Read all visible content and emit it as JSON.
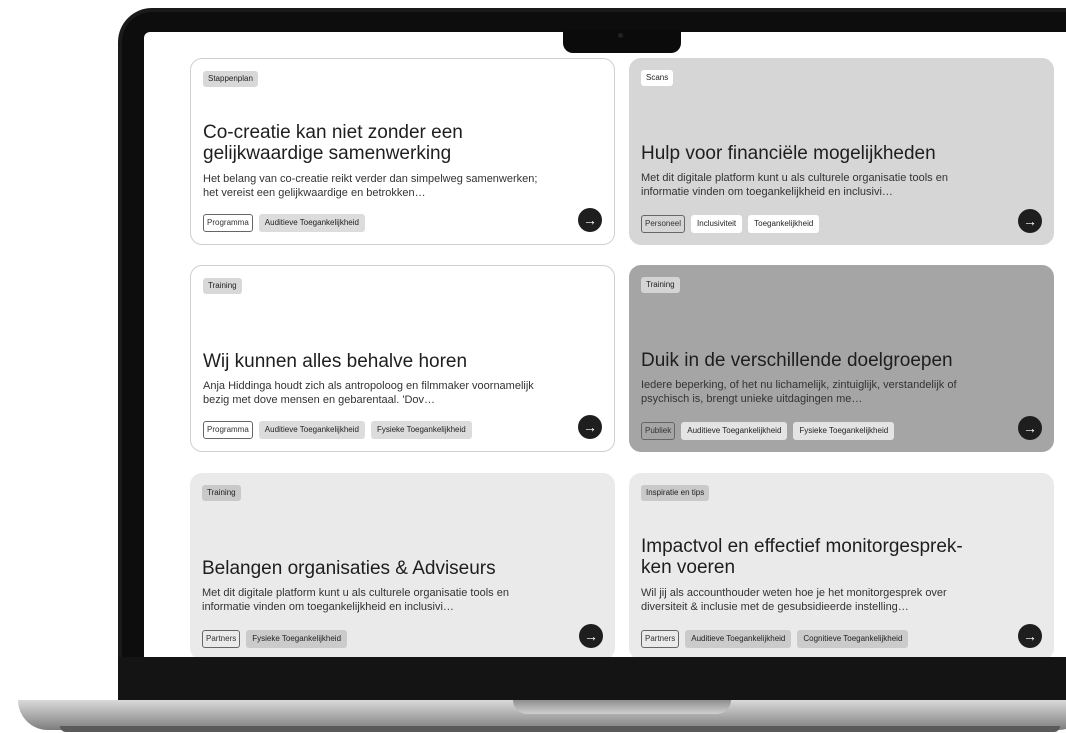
{
  "cards": [
    {
      "type": "Stappenplan",
      "title": "Co-creatie kan niet zonder een gelijkwaardige samenwerking",
      "description": "Het belang van co-creatie reikt verder dan simpelweg samenwerken; het vereist een gelijkwaardige en betrokken…",
      "audience": "Programma",
      "tags": [
        "Auditieve Toegankelijkheid"
      ]
    },
    {
      "type": "Scans",
      "title": "Hulp voor financiële mogelijkheden",
      "description": "Met dit digitale platform kunt u als culturele organisatie tools en informatie vinden om toegankelijkheid en inclusivi…",
      "audience": "Personeel",
      "tags": [
        "Inclusiviteit",
        "Toegankelijkheid"
      ]
    },
    {
      "type": "Training",
      "title": "Wij kunnen alles behalve horen",
      "description": "Anja Hiddinga houdt zich als antropoloog en filmmaker voornamelijk bezig met dove mensen en gebarentaal. 'Dov…",
      "audience": "Programma",
      "tags": [
        "Auditieve Toegankelijkheid",
        "Fysieke Toegankelijkheid"
      ]
    },
    {
      "type": "Training",
      "title": "Duik in de verschillende doelgroepen",
      "description": "Iedere beperking, of het nu lichamelijk, zintuiglijk, verstandelijk of psychisch is, brengt unieke uitdagingen me…",
      "audience": "Publiek",
      "tags": [
        "Auditieve Toegankelijkheid",
        "Fysieke Toegankelijkheid"
      ]
    },
    {
      "type": "Training",
      "title": "Belangen organisaties & Adviseurs",
      "description": "Met dit digitale platform kunt u als culturele organisatie tools en informatie vinden om toegankelijkheid en inclusivi…",
      "audience": "Partners",
      "tags": [
        "Fysieke Toegankelijkheid"
      ]
    },
    {
      "type": "Inspiratie en tips",
      "title": "Impactvol en effectief monitorgesprek-ken voeren",
      "description": "Wil jij als accounthouder weten hoe je het monitorgesprek over diversiteit & inclusie met de gesubsidieerde instelling…",
      "audience": "Partners",
      "tags": [
        "Auditieve Toegankelijkheid",
        "Cognitieve Toegankelijkheid"
      ]
    }
  ],
  "icons": {
    "card_link": "arrow-right-icon",
    "camera": "camera-icon"
  }
}
